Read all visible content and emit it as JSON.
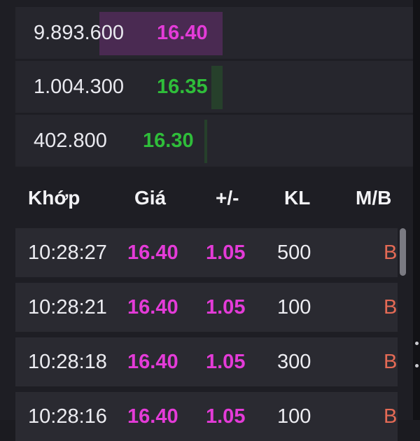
{
  "order_book": {
    "rows": [
      {
        "volume": "9.893.600",
        "price": "16.40",
        "price_color": "#e43bd8",
        "bar_color": "#4a2a52",
        "depth_fraction": 1.0
      },
      {
        "volume": "1.004.300",
        "price": "16.35",
        "price_color": "#2fbd3a",
        "bar_color": "#26402b",
        "depth_fraction": 0.05
      },
      {
        "volume": "402.800",
        "price": "16.30",
        "price_color": "#2fbd3a",
        "bar_color": "#26402b",
        "depth_fraction": 0.02
      }
    ]
  },
  "trades": {
    "headers": {
      "time": "Khớp",
      "price": "Giá",
      "change": "+/-",
      "volume": "KL",
      "side": "M/B"
    },
    "rows": [
      {
        "time": "10:28:27",
        "price": "16.40",
        "change": "1.05",
        "volume": "500",
        "side": "B"
      },
      {
        "time": "10:28:21",
        "price": "16.40",
        "change": "1.05",
        "volume": "100",
        "side": "B"
      },
      {
        "time": "10:28:18",
        "price": "16.40",
        "change": "1.05",
        "volume": "300",
        "side": "B"
      },
      {
        "time": "10:28:16",
        "price": "16.40",
        "change": "1.05",
        "volume": "100",
        "side": "B"
      }
    ]
  },
  "colors": {
    "ceiling": "#e43bd8",
    "up": "#2fbd3a",
    "buy_side": "#e46a55"
  }
}
